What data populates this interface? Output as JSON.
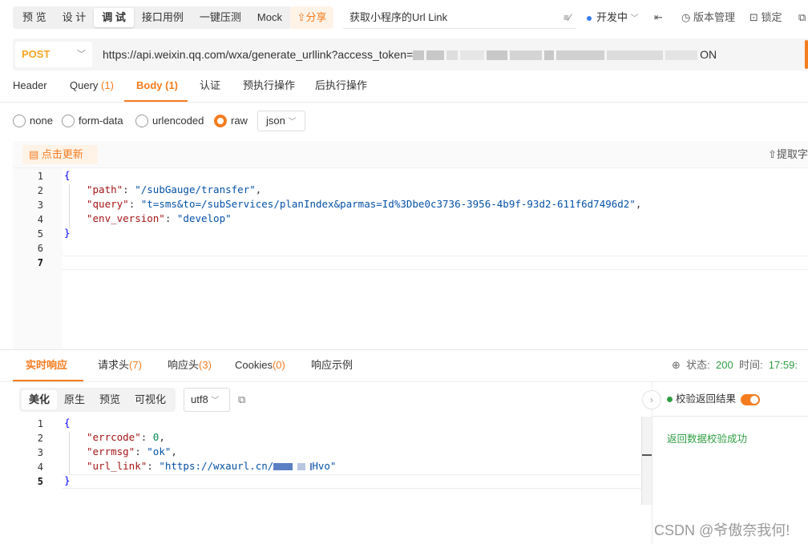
{
  "toolbar": {
    "modes": [
      "预 览",
      "设 计",
      "调 试",
      "接口用例",
      "一键压测",
      "Mock"
    ],
    "active_mode": "调 试",
    "share_label": "分享",
    "api_title": "获取小程序的Url Link",
    "env_label": "开发中",
    "version_label": "版本管理",
    "lock_label": "锁定"
  },
  "request": {
    "method": "POST",
    "url_prefix": "https://api.weixin.qq.com/wxa/generate_urllink?access_token=",
    "url_suffix": "ON"
  },
  "request_tabs": [
    {
      "label": "Header",
      "count": ""
    },
    {
      "label": "Query",
      "count": "(1)"
    },
    {
      "label": "Body",
      "count": "(1)"
    },
    {
      "label": "认证",
      "count": ""
    },
    {
      "label": "预执行操作",
      "count": ""
    },
    {
      "label": "后执行操作",
      "count": ""
    }
  ],
  "body_types": [
    "none",
    "form-data",
    "urlencoded",
    "raw"
  ],
  "selected_body_type": "raw",
  "body_format": "json",
  "editor": {
    "update_label": "点击更新",
    "extract_label": "提取字",
    "line_numbers": [
      "1",
      "2",
      "3",
      "4",
      "5",
      "6",
      "7"
    ],
    "path_key": "\"path\"",
    "path_val": "\"/subGauge/transfer\"",
    "query_key": "\"query\"",
    "query_val": "\"t=sms&to=/subServices/planIndex&parmas=Id%3Dbe0c3736-3956-4b9f-93d2-611f6d7496d2\"",
    "env_key": "\"env_version\"",
    "env_val": "\"develop\""
  },
  "response_tabs": [
    {
      "label": "实时响应",
      "count": ""
    },
    {
      "label": "请求头",
      "count": "(7)"
    },
    {
      "label": "响应头",
      "count": "(3)"
    },
    {
      "label": "Cookies",
      "count": "(0)"
    },
    {
      "label": "响应示例",
      "count": ""
    }
  ],
  "status": {
    "status_label": "状态:",
    "status_code": "200",
    "time_label": "时间:",
    "time_value": "17:59:"
  },
  "view_modes": [
    "美化",
    "原生",
    "预览",
    "可视化"
  ],
  "active_view": "美化",
  "encoding": "utf8",
  "response": {
    "line_numbers": [
      "1",
      "2",
      "3",
      "4",
      "5"
    ],
    "errcode_key": "\"errcode\"",
    "errcode_val": "0",
    "errmsg_key": "\"errmsg\"",
    "errmsg_val": "\"ok\"",
    "url_key": "\"url_link\"",
    "url_val_prefix": "\"https://wxaurl.cn/",
    "url_val_suffix": "Hvo\""
  },
  "validation": {
    "label": "校验返回结果",
    "enabled": true,
    "message": "返回数据校验成功"
  },
  "watermark": "CSDN @爷傲奈我何!",
  "colors": {
    "accent": "#f57c1f",
    "success": "#2f9e44",
    "method": "#f5a623"
  }
}
